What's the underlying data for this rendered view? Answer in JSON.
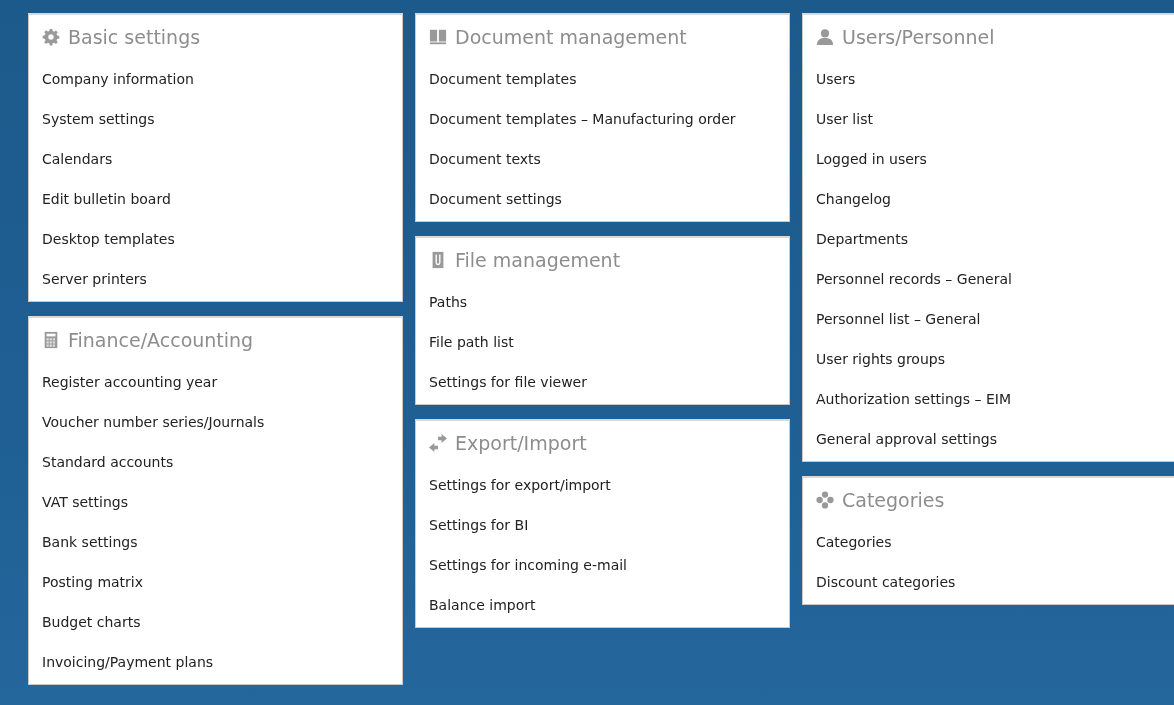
{
  "columns": [
    {
      "sections": [
        {
          "kind": "gear",
          "title": "Basic settings",
          "items": [
            "Company information",
            "System settings",
            "Calendars",
            "Edit bulletin board",
            "Desktop templates",
            "Server printers"
          ]
        },
        {
          "kind": "calculator",
          "title": "Finance/Accounting",
          "items": [
            "Register accounting year",
            "Voucher number series/Journals",
            "Standard accounts",
            "VAT settings",
            "Bank settings",
            "Posting matrix",
            "Budget charts",
            "Invoicing/Payment plans"
          ]
        }
      ]
    },
    {
      "sections": [
        {
          "kind": "book",
          "title": "Document management",
          "items": [
            "Document templates",
            "Document templates – Manufacturing order",
            "Document texts",
            "Document settings"
          ]
        },
        {
          "kind": "clip",
          "title": "File management",
          "items": [
            "Paths",
            "File path list",
            "Settings for file viewer"
          ]
        },
        {
          "kind": "arrows",
          "title": "Export/Import",
          "items": [
            "Settings for export/import",
            "Settings for BI",
            "Settings for incoming e-mail",
            "Balance import"
          ]
        }
      ]
    },
    {
      "sections": [
        {
          "kind": "user",
          "title": "Users/Personnel",
          "items": [
            "Users",
            "User list",
            "Logged in users",
            "Changelog",
            "Departments",
            "Personnel records – General",
            "Personnel list – General",
            "User rights groups",
            "Authorization settings – EIM",
            "General approval settings"
          ]
        },
        {
          "kind": "dots",
          "title": "Categories",
          "items": [
            "Categories",
            "Discount categories"
          ]
        }
      ]
    }
  ]
}
